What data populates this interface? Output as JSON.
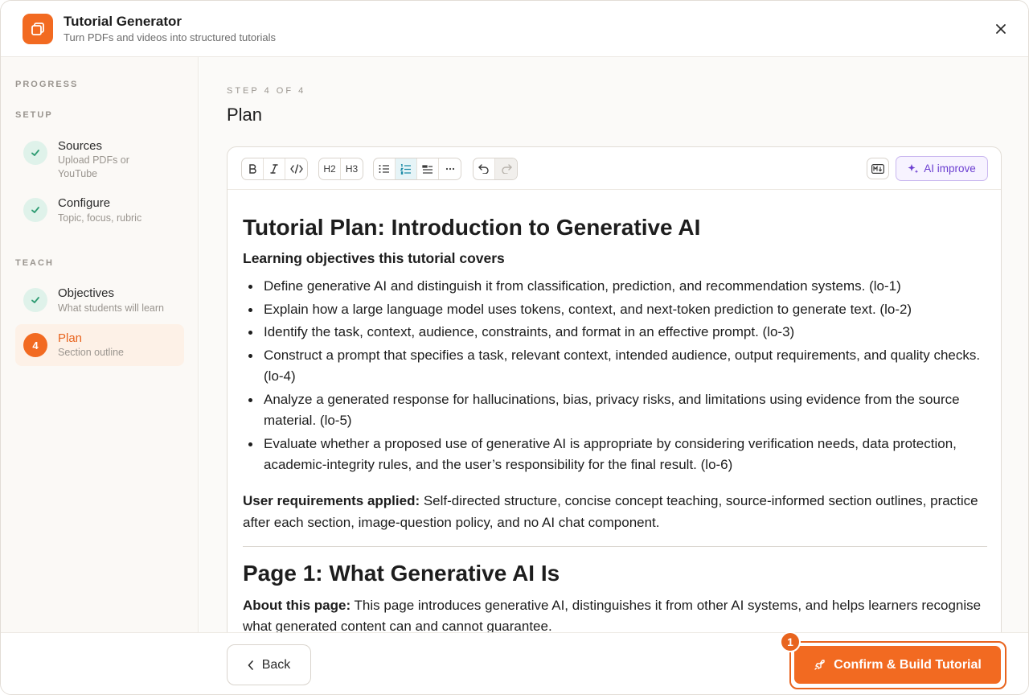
{
  "header": {
    "title": "Tutorial Generator",
    "subtitle": "Turn PDFs and videos into structured tutorials"
  },
  "sidebar": {
    "progress_label": "PROGRESS",
    "setup_label": "SETUP",
    "teach_label": "TEACH",
    "steps": [
      {
        "title": "Sources",
        "desc": "Upload PDFs or YouTube",
        "state": "done"
      },
      {
        "title": "Configure",
        "desc": "Topic, focus, rubric",
        "state": "done"
      },
      {
        "title": "Objectives",
        "desc": "What students will learn",
        "state": "done"
      },
      {
        "title": "Plan",
        "desc": "Section outline",
        "state": "current",
        "number": "4"
      }
    ]
  },
  "main": {
    "step_counter": "STEP 4 OF 4",
    "title": "Plan"
  },
  "toolbar": {
    "h2_label": "H2",
    "h3_label": "H3",
    "ai_improve_label": "AI improve"
  },
  "document": {
    "h1": "Tutorial Plan: Introduction to Generative AI",
    "objectives_heading": "Learning objectives this tutorial covers",
    "objectives": [
      "Define generative AI and distinguish it from classification, prediction, and recommendation systems. (lo-1)",
      "Explain how a large language model uses tokens, context, and next-token prediction to generate text. (lo-2)",
      "Identify the task, context, audience, constraints, and format in an effective prompt. (lo-3)",
      "Construct a prompt that specifies a task, relevant context, intended audience, output requirements, and quality checks. (lo-4)",
      "Analyze a generated response for hallucinations, bias, privacy risks, and limitations using evidence from the source material. (lo-5)",
      "Evaluate whether a proposed use of generative AI is appropriate by considering verification needs, data protection, academic-integrity rules, and the user’s responsibility for the final result. (lo-6)"
    ],
    "requirements_label": "User requirements applied:",
    "requirements_text": " Self-directed structure, concise concept teaching, source-informed section outlines, practice after each section, image-question policy, and no AI chat component.",
    "page1_heading": "Page 1: What Generative AI Is",
    "about_label": "About this page:",
    "about_text": " This page introduces generative AI, distinguishes it from other AI systems, and helps learners recognise what generated content can and cannot guarantee."
  },
  "footer": {
    "back_label": "Back",
    "confirm_label": "Confirm & Build Tutorial",
    "badge": "1"
  },
  "colors": {
    "accent": "#f26a21",
    "done_bg": "#dff2ea",
    "done_check": "#2f9c73",
    "ai_purple": "#6c3fd1"
  }
}
